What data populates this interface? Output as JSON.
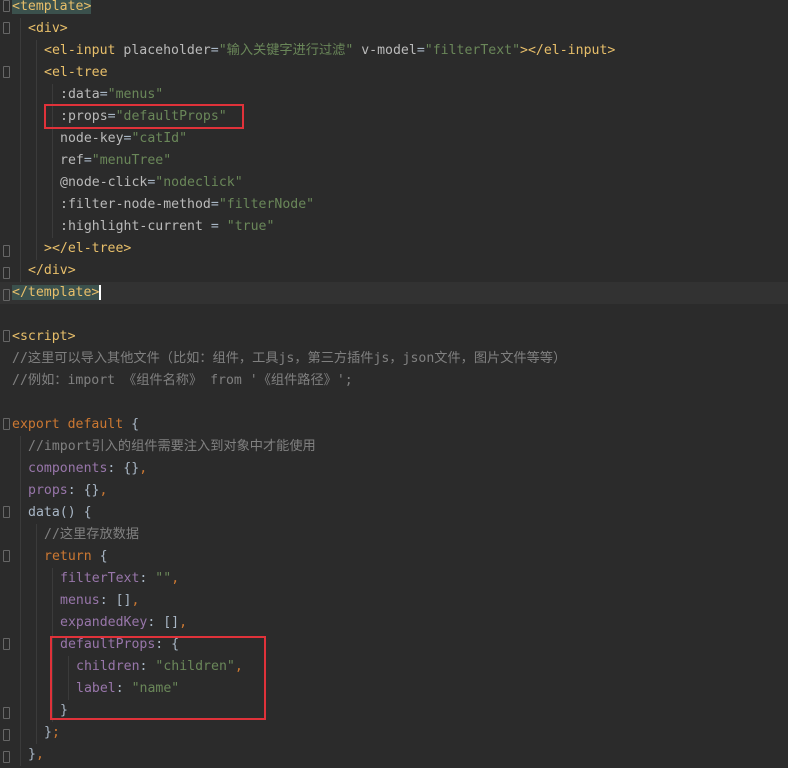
{
  "theme": {
    "background": "#2b2b2b",
    "tag": "#e8bf6a",
    "string": "#6a8759",
    "keyword": "#cc7832",
    "property": "#9876aa",
    "comment": "#808080",
    "text": "#a9b7c6",
    "annotation_box": "#e0323a"
  },
  "code": {
    "lines": [
      {
        "indent": 0,
        "fold": "down",
        "tokens": [
          {
            "t": "<template>",
            "c": "hl"
          }
        ]
      },
      {
        "indent": 1,
        "fold": "down",
        "tokens": [
          {
            "t": "<div>",
            "c": "tag"
          }
        ]
      },
      {
        "indent": 2,
        "tokens": [
          {
            "t": "<el-input ",
            "c": "tag"
          },
          {
            "t": "placeholder",
            "c": "attr"
          },
          {
            "t": "=",
            "c": "plain"
          },
          {
            "t": "\"输入关键字进行过滤\"",
            "c": "str"
          },
          {
            "t": " ",
            "c": "plain"
          },
          {
            "t": "v-model",
            "c": "attr"
          },
          {
            "t": "=",
            "c": "plain"
          },
          {
            "t": "\"filterText\"",
            "c": "str"
          },
          {
            "t": "></el-input>",
            "c": "tag"
          }
        ]
      },
      {
        "indent": 2,
        "fold": "down",
        "tokens": [
          {
            "t": "<el-tree",
            "c": "tag"
          }
        ]
      },
      {
        "indent": 3,
        "tokens": [
          {
            "t": ":data",
            "c": "attr"
          },
          {
            "t": "=",
            "c": "plain"
          },
          {
            "t": "\"menus\"",
            "c": "str"
          }
        ]
      },
      {
        "indent": 3,
        "tokens": [
          {
            "t": ":props",
            "c": "attr"
          },
          {
            "t": "=",
            "c": "plain"
          },
          {
            "t": "\"defaultProps\"",
            "c": "str"
          }
        ]
      },
      {
        "indent": 3,
        "tokens": [
          {
            "t": "node-key",
            "c": "attr"
          },
          {
            "t": "=",
            "c": "plain"
          },
          {
            "t": "\"catId\"",
            "c": "str"
          }
        ]
      },
      {
        "indent": 3,
        "tokens": [
          {
            "t": "ref",
            "c": "attr"
          },
          {
            "t": "=",
            "c": "plain"
          },
          {
            "t": "\"menuTree\"",
            "c": "str"
          }
        ]
      },
      {
        "indent": 3,
        "tokens": [
          {
            "t": "@node-click",
            "c": "attr"
          },
          {
            "t": "=",
            "c": "plain"
          },
          {
            "t": "\"nodeclick\"",
            "c": "str"
          }
        ]
      },
      {
        "indent": 3,
        "tokens": [
          {
            "t": ":filter-node-method",
            "c": "attr"
          },
          {
            "t": "=",
            "c": "plain"
          },
          {
            "t": "\"filterNode\"",
            "c": "str"
          }
        ]
      },
      {
        "indent": 3,
        "tokens": [
          {
            "t": ":highlight-current ",
            "c": "attr"
          },
          {
            "t": "= ",
            "c": "plain"
          },
          {
            "t": "\"true\"",
            "c": "str"
          }
        ]
      },
      {
        "indent": 2,
        "fold": "up",
        "tokens": [
          {
            "t": "></el-tree>",
            "c": "tag"
          }
        ]
      },
      {
        "indent": 1,
        "fold": "up",
        "tokens": [
          {
            "t": "</div>",
            "c": "tag"
          }
        ]
      },
      {
        "indent": 0,
        "fold": "up",
        "current": true,
        "tokens": [
          {
            "t": "</template>",
            "c": "hl"
          },
          {
            "t": "",
            "c": "caret"
          }
        ]
      },
      {
        "indent": 0,
        "tokens": []
      },
      {
        "indent": 0,
        "fold": "down",
        "tokens": [
          {
            "t": "<script>",
            "c": "tag"
          }
        ]
      },
      {
        "indent": 0,
        "tokens": [
          {
            "t": "//这里可以导入其他文件（比如：组件，工具js，第三方插件js，json文件，图片文件等等）",
            "c": "comment"
          }
        ]
      },
      {
        "indent": 0,
        "tokens": [
          {
            "t": "//例如：import 《组件名称》 from '《组件路径》';",
            "c": "comment"
          }
        ]
      },
      {
        "indent": 0,
        "tokens": []
      },
      {
        "indent": 0,
        "fold": "down",
        "tokens": [
          {
            "t": "export ",
            "c": "kw"
          },
          {
            "t": "default ",
            "c": "kw"
          },
          {
            "t": "{",
            "c": "plain"
          }
        ]
      },
      {
        "indent": 1,
        "tokens": [
          {
            "t": "//import引入的组件需要注入到对象中才能使用",
            "c": "comment"
          }
        ]
      },
      {
        "indent": 1,
        "tokens": [
          {
            "t": "components",
            "c": "prop"
          },
          {
            "t": ": ",
            "c": "plain"
          },
          {
            "t": "{}",
            "c": "plain"
          },
          {
            "t": ",",
            "c": "kw"
          }
        ]
      },
      {
        "indent": 1,
        "tokens": [
          {
            "t": "props",
            "c": "prop"
          },
          {
            "t": ": ",
            "c": "plain"
          },
          {
            "t": "{}",
            "c": "plain"
          },
          {
            "t": ",",
            "c": "kw"
          }
        ]
      },
      {
        "indent": 1,
        "fold": "down",
        "tokens": [
          {
            "t": "data",
            "c": "plain"
          },
          {
            "t": "() ",
            "c": "plain"
          },
          {
            "t": "{",
            "c": "plain"
          }
        ]
      },
      {
        "indent": 2,
        "tokens": [
          {
            "t": "//这里存放数据",
            "c": "comment"
          }
        ]
      },
      {
        "indent": 2,
        "fold": "down",
        "tokens": [
          {
            "t": "return ",
            "c": "kw"
          },
          {
            "t": "{",
            "c": "plain"
          }
        ]
      },
      {
        "indent": 3,
        "tokens": [
          {
            "t": "filterText",
            "c": "prop"
          },
          {
            "t": ": ",
            "c": "plain"
          },
          {
            "t": "\"\"",
            "c": "str"
          },
          {
            "t": ",",
            "c": "kw"
          }
        ]
      },
      {
        "indent": 3,
        "tokens": [
          {
            "t": "menus",
            "c": "prop"
          },
          {
            "t": ": ",
            "c": "plain"
          },
          {
            "t": "[]",
            "c": "plain"
          },
          {
            "t": ",",
            "c": "kw"
          }
        ]
      },
      {
        "indent": 3,
        "tokens": [
          {
            "t": "expandedKey",
            "c": "prop"
          },
          {
            "t": ": ",
            "c": "plain"
          },
          {
            "t": "[]",
            "c": "plain"
          },
          {
            "t": ",",
            "c": "kw"
          }
        ]
      },
      {
        "indent": 3,
        "fold": "down",
        "tokens": [
          {
            "t": "defaultProps",
            "c": "prop"
          },
          {
            "t": ": ",
            "c": "plain"
          },
          {
            "t": "{",
            "c": "plain"
          }
        ]
      },
      {
        "indent": 4,
        "tokens": [
          {
            "t": "children",
            "c": "prop"
          },
          {
            "t": ": ",
            "c": "plain"
          },
          {
            "t": "\"children\"",
            "c": "str"
          },
          {
            "t": ",",
            "c": "kw"
          }
        ]
      },
      {
        "indent": 4,
        "tokens": [
          {
            "t": "label",
            "c": "prop"
          },
          {
            "t": ": ",
            "c": "plain"
          },
          {
            "t": "\"name\"",
            "c": "str"
          }
        ]
      },
      {
        "indent": 3,
        "fold": "up",
        "tokens": [
          {
            "t": "}",
            "c": "plain"
          }
        ]
      },
      {
        "indent": 2,
        "fold": "up",
        "tokens": [
          {
            "t": "}",
            "c": "plain"
          },
          {
            "t": ";",
            "c": "kw"
          }
        ]
      },
      {
        "indent": 1,
        "fold": "up",
        "tokens": [
          {
            "t": "}",
            "c": "plain"
          },
          {
            "t": ",",
            "c": "kw"
          }
        ]
      }
    ]
  }
}
